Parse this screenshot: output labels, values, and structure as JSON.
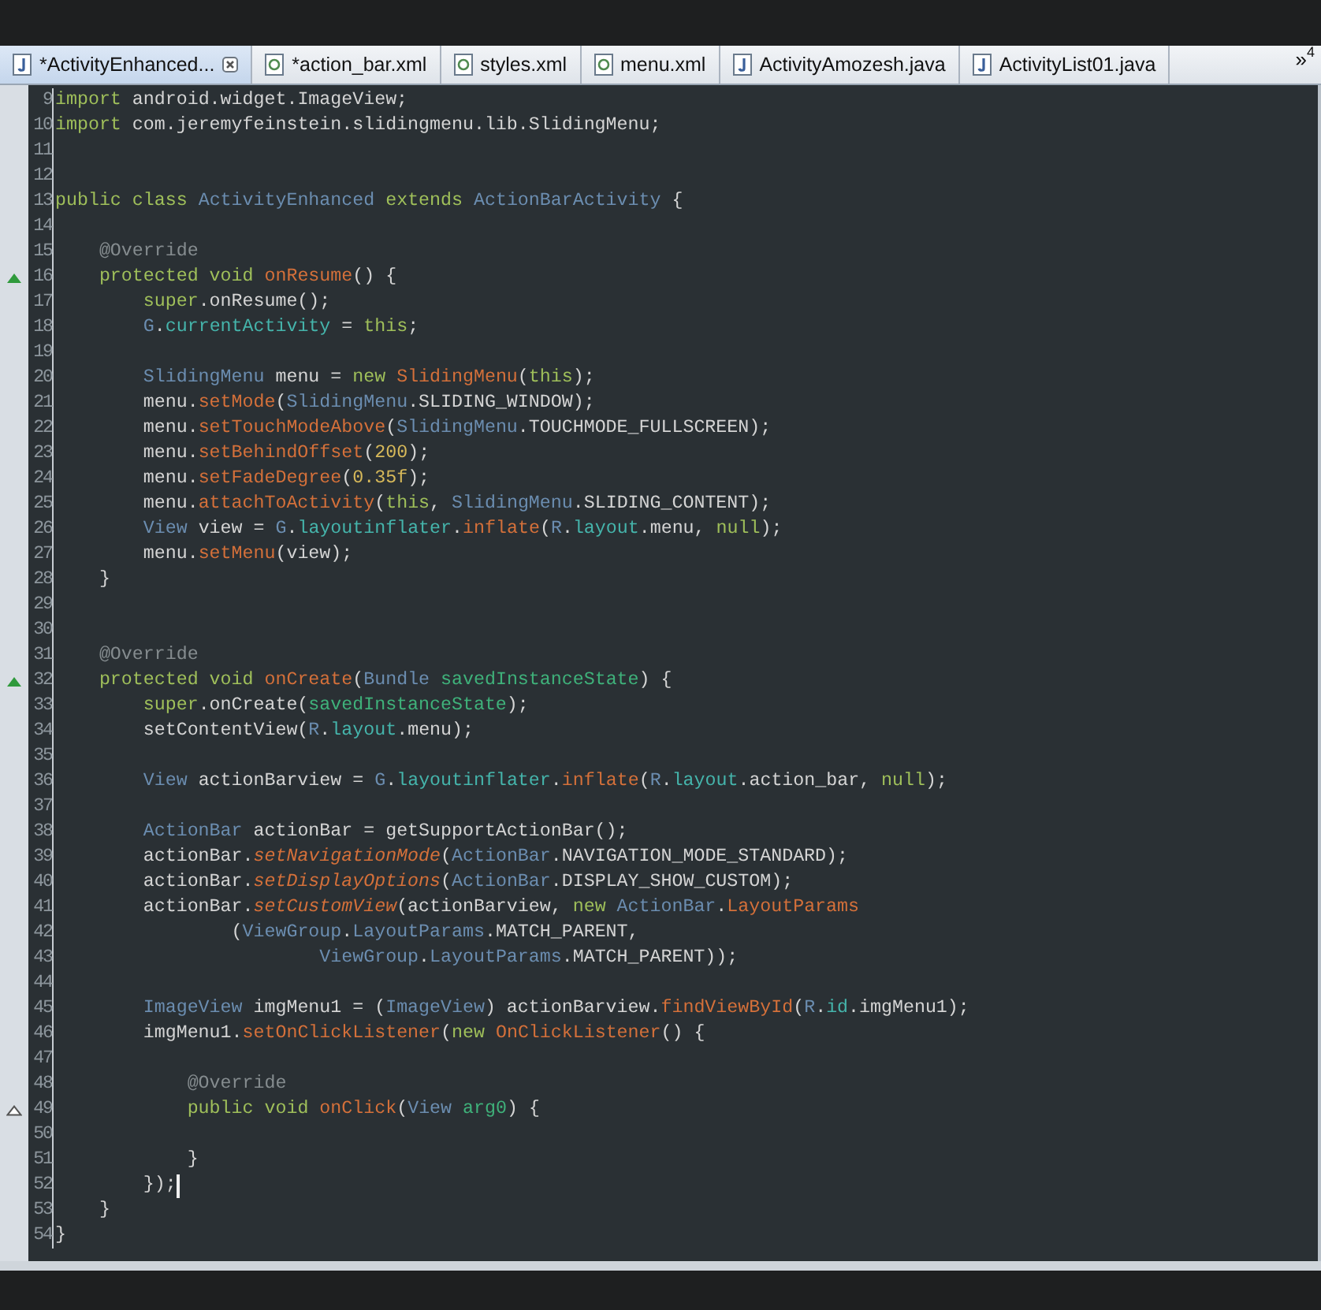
{
  "tabs": [
    {
      "label": "*ActivityEnhanced...",
      "kind": "java",
      "selected": true
    },
    {
      "label": "*action_bar.xml",
      "kind": "xml",
      "selected": false
    },
    {
      "label": "styles.xml",
      "kind": "xml",
      "selected": false
    },
    {
      "label": "menu.xml",
      "kind": "xml",
      "selected": false
    },
    {
      "label": "ActivityAmozesh.java",
      "kind": "java",
      "selected": false
    },
    {
      "label": "ActivityList01.java",
      "kind": "java",
      "selected": false
    }
  ],
  "tab_overflow": {
    "symbol": "»",
    "count": "4"
  },
  "editor": {
    "lines": [
      {
        "number": "9",
        "tokens": [
          {
            "text": "import",
            "kind": "keyword"
          },
          {
            "text": " android.widget.ImageView;",
            "kind": "plain"
          }
        ]
      },
      {
        "number": "10",
        "tokens": [
          {
            "text": "import",
            "kind": "keyword"
          },
          {
            "text": " com.jeremyfeinstein.slidingmenu.lib.SlidingMenu;",
            "kind": "plain"
          }
        ]
      },
      {
        "number": "11"
      },
      {
        "number": "12"
      },
      {
        "number": "13",
        "tokens": [
          {
            "text": "public",
            "kind": "keyword"
          },
          {
            "text": " class",
            "kind": "keyword"
          },
          {
            "text": " ActivityEnhanced",
            "kind": "type"
          },
          {
            "text": " extends",
            "kind": "keyword"
          },
          {
            "text": " ActionBarActivity",
            "kind": "type"
          },
          {
            "text": " {",
            "kind": "plain"
          }
        ]
      },
      {
        "number": "14"
      },
      {
        "number": "15",
        "tokens": [
          {
            "text": "    @Override",
            "kind": "annotation"
          }
        ]
      },
      {
        "number": "16",
        "marker": {
          "kind": "override"
        },
        "tokens": [
          {
            "text": "    protected",
            "kind": "keyword"
          },
          {
            "text": " void",
            "kind": "keyword"
          },
          {
            "text": " onResume",
            "kind": "method"
          },
          {
            "text": "() {",
            "kind": "plain"
          }
        ]
      },
      {
        "number": "17",
        "tokens": [
          {
            "text": "        super",
            "kind": "keyword"
          },
          {
            "text": ".onResume();",
            "kind": "plain"
          }
        ]
      },
      {
        "number": "18",
        "tokens": [
          {
            "text": "        G",
            "kind": "type"
          },
          {
            "text": ".",
            "kind": "plain"
          },
          {
            "text": "currentActivity",
            "kind": "field"
          },
          {
            "text": " = ",
            "kind": "plain"
          },
          {
            "text": "this",
            "kind": "keyword"
          },
          {
            "text": ";",
            "kind": "plain"
          }
        ]
      },
      {
        "number": "19"
      },
      {
        "number": "20",
        "tokens": [
          {
            "text": "        SlidingMenu",
            "kind": "type"
          },
          {
            "text": " menu = ",
            "kind": "plain"
          },
          {
            "text": "new",
            "kind": "keyword"
          },
          {
            "text": " SlidingMenu",
            "kind": "method"
          },
          {
            "text": "(",
            "kind": "plain"
          },
          {
            "text": "this",
            "kind": "keyword"
          },
          {
            "text": ");",
            "kind": "plain"
          }
        ]
      },
      {
        "number": "21",
        "tokens": [
          {
            "text": "        menu.",
            "kind": "plain"
          },
          {
            "text": "setMode",
            "kind": "method"
          },
          {
            "text": "(",
            "kind": "plain"
          },
          {
            "text": "SlidingMenu",
            "kind": "type"
          },
          {
            "text": ".SLIDING_WINDOW);",
            "kind": "plain"
          }
        ]
      },
      {
        "number": "22",
        "tokens": [
          {
            "text": "        menu.",
            "kind": "plain"
          },
          {
            "text": "setTouchModeAbove",
            "kind": "method"
          },
          {
            "text": "(",
            "kind": "plain"
          },
          {
            "text": "SlidingMenu",
            "kind": "type"
          },
          {
            "text": ".TOUCHMODE_FULLSCREEN);",
            "kind": "plain"
          }
        ]
      },
      {
        "number": "23",
        "tokens": [
          {
            "text": "        menu.",
            "kind": "plain"
          },
          {
            "text": "setBehindOffset",
            "kind": "method"
          },
          {
            "text": "(",
            "kind": "plain"
          },
          {
            "text": "200",
            "kind": "number"
          },
          {
            "text": ");",
            "kind": "plain"
          }
        ]
      },
      {
        "number": "24",
        "tokens": [
          {
            "text": "        menu.",
            "kind": "plain"
          },
          {
            "text": "setFadeDegree",
            "kind": "method"
          },
          {
            "text": "(",
            "kind": "plain"
          },
          {
            "text": "0.35f",
            "kind": "number"
          },
          {
            "text": ");",
            "kind": "plain"
          }
        ]
      },
      {
        "number": "25",
        "tokens": [
          {
            "text": "        menu.",
            "kind": "plain"
          },
          {
            "text": "attachToActivity",
            "kind": "method"
          },
          {
            "text": "(",
            "kind": "plain"
          },
          {
            "text": "this",
            "kind": "keyword"
          },
          {
            "text": ", ",
            "kind": "plain"
          },
          {
            "text": "SlidingMenu",
            "kind": "type"
          },
          {
            "text": ".SLIDING_CONTENT);",
            "kind": "plain"
          }
        ]
      },
      {
        "number": "26",
        "tokens": [
          {
            "text": "        View",
            "kind": "type"
          },
          {
            "text": " view = ",
            "kind": "plain"
          },
          {
            "text": "G",
            "kind": "type"
          },
          {
            "text": ".",
            "kind": "plain"
          },
          {
            "text": "layoutinflater",
            "kind": "field"
          },
          {
            "text": ".",
            "kind": "plain"
          },
          {
            "text": "inflate",
            "kind": "method"
          },
          {
            "text": "(",
            "kind": "plain"
          },
          {
            "text": "R",
            "kind": "type"
          },
          {
            "text": ".",
            "kind": "plain"
          },
          {
            "text": "layout",
            "kind": "field"
          },
          {
            "text": ".menu, ",
            "kind": "plain"
          },
          {
            "text": "null",
            "kind": "keyword"
          },
          {
            "text": ");",
            "kind": "plain"
          }
        ]
      },
      {
        "number": "27",
        "tokens": [
          {
            "text": "        menu.",
            "kind": "plain"
          },
          {
            "text": "setMenu",
            "kind": "method"
          },
          {
            "text": "(view);",
            "kind": "plain"
          }
        ]
      },
      {
        "number": "28",
        "tokens": [
          {
            "text": "    }",
            "kind": "plain"
          }
        ]
      },
      {
        "number": "29"
      },
      {
        "number": "30"
      },
      {
        "number": "31",
        "tokens": [
          {
            "text": "    @Override",
            "kind": "annotation"
          }
        ]
      },
      {
        "number": "32",
        "marker": {
          "kind": "override"
        },
        "tokens": [
          {
            "text": "    protected",
            "kind": "keyword"
          },
          {
            "text": " void",
            "kind": "keyword"
          },
          {
            "text": " onCreate",
            "kind": "method"
          },
          {
            "text": "(",
            "kind": "plain"
          },
          {
            "text": "Bundle",
            "kind": "type"
          },
          {
            "text": " savedInstanceState",
            "kind": "parameter"
          },
          {
            "text": ") {",
            "kind": "plain"
          }
        ]
      },
      {
        "number": "33",
        "tokens": [
          {
            "text": "        super",
            "kind": "keyword"
          },
          {
            "text": ".onCreate(",
            "kind": "plain"
          },
          {
            "text": "savedInstanceState",
            "kind": "parameter"
          },
          {
            "text": ");",
            "kind": "plain"
          }
        ]
      },
      {
        "number": "34",
        "tokens": [
          {
            "text": "        setContentView(",
            "kind": "plain"
          },
          {
            "text": "R",
            "kind": "type"
          },
          {
            "text": ".",
            "kind": "plain"
          },
          {
            "text": "layout",
            "kind": "field"
          },
          {
            "text": ".menu);",
            "kind": "plain"
          }
        ]
      },
      {
        "number": "35"
      },
      {
        "number": "36",
        "tokens": [
          {
            "text": "        View",
            "kind": "type"
          },
          {
            "text": " actionBarview = ",
            "kind": "plain"
          },
          {
            "text": "G",
            "kind": "type"
          },
          {
            "text": ".",
            "kind": "plain"
          },
          {
            "text": "layoutinflater",
            "kind": "field"
          },
          {
            "text": ".",
            "kind": "plain"
          },
          {
            "text": "inflate",
            "kind": "method"
          },
          {
            "text": "(",
            "kind": "plain"
          },
          {
            "text": "R",
            "kind": "type"
          },
          {
            "text": ".",
            "kind": "plain"
          },
          {
            "text": "layout",
            "kind": "field"
          },
          {
            "text": ".action_bar, ",
            "kind": "plain"
          },
          {
            "text": "null",
            "kind": "keyword"
          },
          {
            "text": ");",
            "kind": "plain"
          }
        ]
      },
      {
        "number": "37"
      },
      {
        "number": "38",
        "tokens": [
          {
            "text": "        ActionBar",
            "kind": "type"
          },
          {
            "text": " actionBar = getSupportActionBar();",
            "kind": "plain"
          }
        ]
      },
      {
        "number": "39",
        "tokens": [
          {
            "text": "        actionBar.",
            "kind": "plain"
          },
          {
            "text": "setNavigationMode",
            "kind": "static"
          },
          {
            "text": "(",
            "kind": "plain"
          },
          {
            "text": "ActionBar",
            "kind": "type"
          },
          {
            "text": ".NAVIGATION_MODE_STANDARD);",
            "kind": "plain"
          }
        ]
      },
      {
        "number": "40",
        "tokens": [
          {
            "text": "        actionBar.",
            "kind": "plain"
          },
          {
            "text": "setDisplayOptions",
            "kind": "static"
          },
          {
            "text": "(",
            "kind": "plain"
          },
          {
            "text": "ActionBar",
            "kind": "type"
          },
          {
            "text": ".DISPLAY_SHOW_CUSTOM);",
            "kind": "plain"
          }
        ]
      },
      {
        "number": "41",
        "tokens": [
          {
            "text": "        actionBar.",
            "kind": "plain"
          },
          {
            "text": "setCustomView",
            "kind": "static"
          },
          {
            "text": "(actionBarview, ",
            "kind": "plain"
          },
          {
            "text": "new",
            "kind": "keyword"
          },
          {
            "text": " ActionBar",
            "kind": "type"
          },
          {
            "text": ".",
            "kind": "plain"
          },
          {
            "text": "LayoutParams",
            "kind": "method"
          }
        ]
      },
      {
        "number": "42",
        "tokens": [
          {
            "text": "                (",
            "kind": "plain"
          },
          {
            "text": "ViewGroup",
            "kind": "type"
          },
          {
            "text": ".",
            "kind": "plain"
          },
          {
            "text": "LayoutParams",
            "kind": "type"
          },
          {
            "text": ".MATCH_PARENT,",
            "kind": "plain"
          }
        ]
      },
      {
        "number": "43",
        "tokens": [
          {
            "text": "                        ViewGroup",
            "kind": "type"
          },
          {
            "text": ".",
            "kind": "plain"
          },
          {
            "text": "LayoutParams",
            "kind": "type"
          },
          {
            "text": ".MATCH_PARENT));",
            "kind": "plain"
          }
        ]
      },
      {
        "number": "44"
      },
      {
        "number": "45",
        "tokens": [
          {
            "text": "        ImageView",
            "kind": "type"
          },
          {
            "text": " imgMenu1 = (",
            "kind": "plain"
          },
          {
            "text": "ImageView",
            "kind": "type"
          },
          {
            "text": ") actionBarview.",
            "kind": "plain"
          },
          {
            "text": "findViewById",
            "kind": "method"
          },
          {
            "text": "(",
            "kind": "plain"
          },
          {
            "text": "R",
            "kind": "type"
          },
          {
            "text": ".",
            "kind": "plain"
          },
          {
            "text": "id",
            "kind": "field"
          },
          {
            "text": ".imgMenu1);",
            "kind": "plain"
          }
        ]
      },
      {
        "number": "46",
        "tokens": [
          {
            "text": "        imgMenu1.",
            "kind": "plain"
          },
          {
            "text": "setOnClickListener",
            "kind": "method"
          },
          {
            "text": "(",
            "kind": "plain"
          },
          {
            "text": "new",
            "kind": "keyword"
          },
          {
            "text": " OnClickListener",
            "kind": "method"
          },
          {
            "text": "() {",
            "kind": "plain"
          }
        ]
      },
      {
        "number": "47"
      },
      {
        "number": "48",
        "tokens": [
          {
            "text": "            @Override",
            "kind": "annotation"
          }
        ]
      },
      {
        "number": "49",
        "marker": {
          "kind": "implement"
        },
        "tokens": [
          {
            "text": "            public",
            "kind": "keyword"
          },
          {
            "text": " void",
            "kind": "keyword"
          },
          {
            "text": " onClick",
            "kind": "method"
          },
          {
            "text": "(",
            "kind": "plain"
          },
          {
            "text": "View",
            "kind": "type"
          },
          {
            "text": " arg0",
            "kind": "parameter"
          },
          {
            "text": ") {",
            "kind": "plain"
          }
        ]
      },
      {
        "number": "50"
      },
      {
        "number": "51",
        "tokens": [
          {
            "text": "            }",
            "kind": "plain"
          }
        ]
      },
      {
        "number": "52",
        "cursor": true,
        "tokens": [
          {
            "text": "        });",
            "kind": "plain"
          }
        ]
      },
      {
        "number": "53",
        "tokens": [
          {
            "text": "    }",
            "kind": "plain"
          }
        ]
      },
      {
        "number": "54",
        "tokens": [
          {
            "text": "}",
            "kind": "plain"
          }
        ]
      }
    ]
  }
}
